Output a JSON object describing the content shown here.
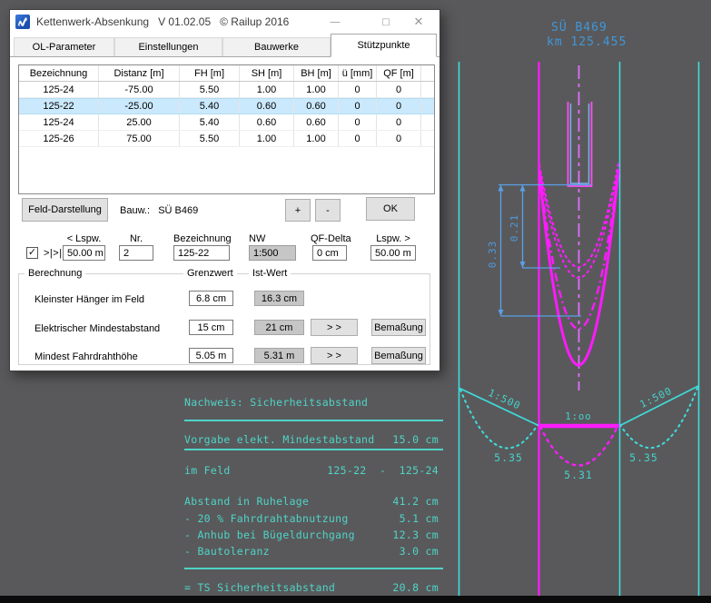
{
  "app": {
    "title": "Kettenwerk-Absenkung   V 01.02.05   © Railup 2016",
    "icons": {
      "minimize": "—",
      "maximize": "□",
      "close": "✕"
    }
  },
  "tabs": {
    "items": [
      "OL-Parameter",
      "Einstellungen",
      "Bauwerke",
      "Stützpunkte"
    ],
    "active": "Stützpunkte"
  },
  "table": {
    "columns": [
      "Bezeichnung",
      "Distanz [m]",
      "FH [m]",
      "SH [m]",
      "BH [m]",
      "ü [mm]",
      "QF [m]"
    ],
    "rows": [
      [
        "125-24",
        "-75.00",
        "5.50",
        "1.00",
        "1.00",
        "0",
        "0"
      ],
      [
        "125-22",
        "-25.00",
        "5.40",
        "0.60",
        "0.60",
        "0",
        "0"
      ],
      [
        "125-24",
        "25.00",
        "5.40",
        "0.60",
        "0.60",
        "0",
        "0"
      ],
      [
        "125-26",
        "75.00",
        "5.50",
        "1.00",
        "1.00",
        "0",
        "0"
      ]
    ],
    "selected_row": "125-22"
  },
  "controls": {
    "feld_button": "Feld-Darstellung",
    "bauw_label": "Bauw.:   SÜ B469",
    "plus": "+",
    "minus": "-",
    "ok": "OK"
  },
  "fields": {
    "checkbox_label": ">|>|",
    "checkbox_glyph": "✓",
    "lspw_left": {
      "label": "< Lspw.",
      "value": "50.00 m"
    },
    "nr": {
      "label": "Nr.",
      "value": "2"
    },
    "bezeichnung": {
      "label": "Bezeichnung",
      "value": "125-22"
    },
    "nw": {
      "label": "NW",
      "value": "1:500"
    },
    "qf_delta": {
      "label": "QF-Delta",
      "value": "0 cm"
    },
    "lspw_right": {
      "label": "Lspw. >",
      "value": "50.00 m"
    }
  },
  "berechnung": {
    "title": "Berechnung",
    "col_grenzwert": "Grenzwert",
    "col_istwert": "Ist-Wert",
    "rows": [
      {
        "label": "Kleinster Hänger im Feld",
        "grenzwert": "6.8 cm",
        "istwert": "16.3 cm"
      },
      {
        "label": "Elektrischer Mindestabstand",
        "grenzwert": "15 cm",
        "istwert": "21 cm",
        "arrows": "> >",
        "bemassung": "Bemaßung"
      },
      {
        "label": "Mindest Fahrdrahthöhe",
        "grenzwert": "5.05 m",
        "istwert": "5.31 m",
        "arrows": "> >",
        "bemassung": "Bemaßung"
      }
    ]
  },
  "drawing": {
    "structure_label": "SÜ B469",
    "km_label": "km 125.455",
    "dim_inner": "0.21",
    "dim_outer": "0.33",
    "slope_left": "1:500",
    "slope_right": "1:500",
    "gradient_label": "1:oo",
    "sag_left": "5.35",
    "sag_right": "5.35",
    "sag_mid": "5.31"
  },
  "report": {
    "title": "Nachweis: Sicherheitsabstand",
    "vorgabe": {
      "label": "Vorgabe elekt. Mindestabstand",
      "value": "15.0 cm"
    },
    "im_feld": {
      "label": "im Feld",
      "value": "125-22  -  125-24"
    },
    "items": [
      {
        "label": "Abstand in Ruhelage",
        "value": "41.2 cm"
      },
      {
        "label": "- 20 % Fahrdrahtabnutzung",
        "value": "5.1 cm"
      },
      {
        "label": "- Anhub bei Bügeldurchgang",
        "value": "12.3 cm"
      },
      {
        "label": "- Bautoleranz",
        "value": "3.0 cm"
      }
    ],
    "total": {
      "label": "= TS Sicherheitsabstand",
      "value": "20.8 cm"
    }
  },
  "colors": {
    "background": "#59595b",
    "cyan": "#3edcdc",
    "teal_text": "#4fd4c7",
    "blue": "#4196d8",
    "magenta": "#ff1aff",
    "violet": "#c97af2",
    "selection": "#cbe9fc"
  }
}
